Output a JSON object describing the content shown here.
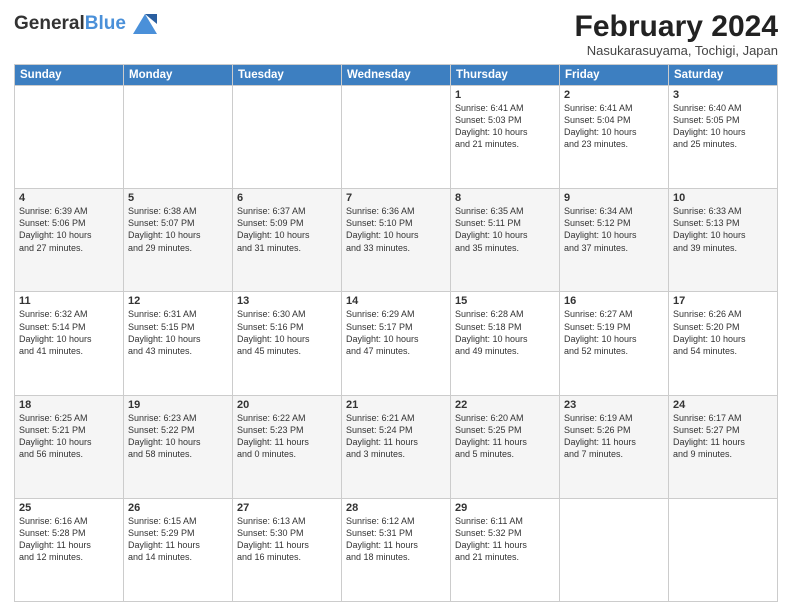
{
  "header": {
    "logo_line1": "General",
    "logo_line2": "Blue",
    "month_title": "February 2024",
    "location": "Nasukarasuyama, Tochigi, Japan"
  },
  "days_of_week": [
    "Sunday",
    "Monday",
    "Tuesday",
    "Wednesday",
    "Thursday",
    "Friday",
    "Saturday"
  ],
  "weeks": [
    [
      {
        "num": "",
        "info": ""
      },
      {
        "num": "",
        "info": ""
      },
      {
        "num": "",
        "info": ""
      },
      {
        "num": "",
        "info": ""
      },
      {
        "num": "1",
        "info": "Sunrise: 6:41 AM\nSunset: 5:03 PM\nDaylight: 10 hours\nand 21 minutes."
      },
      {
        "num": "2",
        "info": "Sunrise: 6:41 AM\nSunset: 5:04 PM\nDaylight: 10 hours\nand 23 minutes."
      },
      {
        "num": "3",
        "info": "Sunrise: 6:40 AM\nSunset: 5:05 PM\nDaylight: 10 hours\nand 25 minutes."
      }
    ],
    [
      {
        "num": "4",
        "info": "Sunrise: 6:39 AM\nSunset: 5:06 PM\nDaylight: 10 hours\nand 27 minutes."
      },
      {
        "num": "5",
        "info": "Sunrise: 6:38 AM\nSunset: 5:07 PM\nDaylight: 10 hours\nand 29 minutes."
      },
      {
        "num": "6",
        "info": "Sunrise: 6:37 AM\nSunset: 5:09 PM\nDaylight: 10 hours\nand 31 minutes."
      },
      {
        "num": "7",
        "info": "Sunrise: 6:36 AM\nSunset: 5:10 PM\nDaylight: 10 hours\nand 33 minutes."
      },
      {
        "num": "8",
        "info": "Sunrise: 6:35 AM\nSunset: 5:11 PM\nDaylight: 10 hours\nand 35 minutes."
      },
      {
        "num": "9",
        "info": "Sunrise: 6:34 AM\nSunset: 5:12 PM\nDaylight: 10 hours\nand 37 minutes."
      },
      {
        "num": "10",
        "info": "Sunrise: 6:33 AM\nSunset: 5:13 PM\nDaylight: 10 hours\nand 39 minutes."
      }
    ],
    [
      {
        "num": "11",
        "info": "Sunrise: 6:32 AM\nSunset: 5:14 PM\nDaylight: 10 hours\nand 41 minutes."
      },
      {
        "num": "12",
        "info": "Sunrise: 6:31 AM\nSunset: 5:15 PM\nDaylight: 10 hours\nand 43 minutes."
      },
      {
        "num": "13",
        "info": "Sunrise: 6:30 AM\nSunset: 5:16 PM\nDaylight: 10 hours\nand 45 minutes."
      },
      {
        "num": "14",
        "info": "Sunrise: 6:29 AM\nSunset: 5:17 PM\nDaylight: 10 hours\nand 47 minutes."
      },
      {
        "num": "15",
        "info": "Sunrise: 6:28 AM\nSunset: 5:18 PM\nDaylight: 10 hours\nand 49 minutes."
      },
      {
        "num": "16",
        "info": "Sunrise: 6:27 AM\nSunset: 5:19 PM\nDaylight: 10 hours\nand 52 minutes."
      },
      {
        "num": "17",
        "info": "Sunrise: 6:26 AM\nSunset: 5:20 PM\nDaylight: 10 hours\nand 54 minutes."
      }
    ],
    [
      {
        "num": "18",
        "info": "Sunrise: 6:25 AM\nSunset: 5:21 PM\nDaylight: 10 hours\nand 56 minutes."
      },
      {
        "num": "19",
        "info": "Sunrise: 6:23 AM\nSunset: 5:22 PM\nDaylight: 10 hours\nand 58 minutes."
      },
      {
        "num": "20",
        "info": "Sunrise: 6:22 AM\nSunset: 5:23 PM\nDaylight: 11 hours\nand 0 minutes."
      },
      {
        "num": "21",
        "info": "Sunrise: 6:21 AM\nSunset: 5:24 PM\nDaylight: 11 hours\nand 3 minutes."
      },
      {
        "num": "22",
        "info": "Sunrise: 6:20 AM\nSunset: 5:25 PM\nDaylight: 11 hours\nand 5 minutes."
      },
      {
        "num": "23",
        "info": "Sunrise: 6:19 AM\nSunset: 5:26 PM\nDaylight: 11 hours\nand 7 minutes."
      },
      {
        "num": "24",
        "info": "Sunrise: 6:17 AM\nSunset: 5:27 PM\nDaylight: 11 hours\nand 9 minutes."
      }
    ],
    [
      {
        "num": "25",
        "info": "Sunrise: 6:16 AM\nSunset: 5:28 PM\nDaylight: 11 hours\nand 12 minutes."
      },
      {
        "num": "26",
        "info": "Sunrise: 6:15 AM\nSunset: 5:29 PM\nDaylight: 11 hours\nand 14 minutes."
      },
      {
        "num": "27",
        "info": "Sunrise: 6:13 AM\nSunset: 5:30 PM\nDaylight: 11 hours\nand 16 minutes."
      },
      {
        "num": "28",
        "info": "Sunrise: 6:12 AM\nSunset: 5:31 PM\nDaylight: 11 hours\nand 18 minutes."
      },
      {
        "num": "29",
        "info": "Sunrise: 6:11 AM\nSunset: 5:32 PM\nDaylight: 11 hours\nand 21 minutes."
      },
      {
        "num": "",
        "info": ""
      },
      {
        "num": "",
        "info": ""
      }
    ]
  ]
}
